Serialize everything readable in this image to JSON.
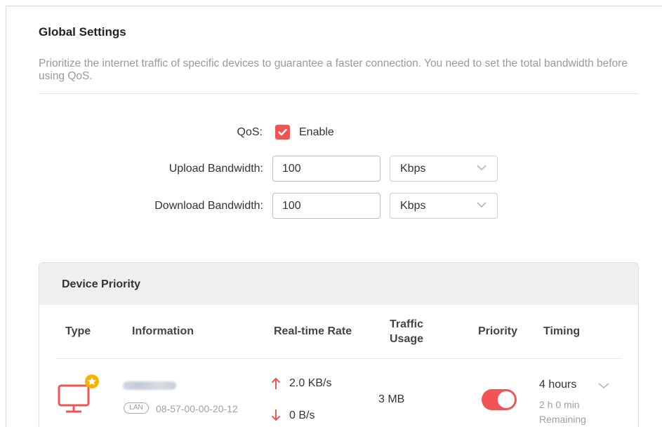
{
  "global": {
    "title": "Global Settings",
    "description": "Prioritize the internet traffic of specific devices to guarantee a faster connection. You need to set the total bandwidth before using QoS."
  },
  "qos": {
    "label": "QoS:",
    "enable_label": "Enable",
    "enabled": true
  },
  "upload": {
    "label": "Upload Bandwidth:",
    "value": "100",
    "unit": "Kbps"
  },
  "download": {
    "label": "Download Bandwidth:",
    "value": "100",
    "unit": "Kbps"
  },
  "device_priority": {
    "title": "Device Priority",
    "columns": {
      "type": "Type",
      "information": "Information",
      "rate": "Real-time Rate",
      "traffic_line1": "Traffic",
      "traffic_line2": "Usage",
      "priority": "Priority",
      "timing": "Timing"
    },
    "rows": [
      {
        "icon": "monitor-icon",
        "badge": "star-icon",
        "connection": "LAN",
        "mac": "08-57-00-00-20-12",
        "upload_rate": "2.0 KB/s",
        "download_rate": "0 B/s",
        "traffic": "3 MB",
        "priority_on": true,
        "timing": "4 hours",
        "remaining_time": "2 h 0 min",
        "remaining_label": "Remaining"
      }
    ]
  },
  "colors": {
    "accent": "#f25454",
    "muted_text": "#9a9a9a",
    "header_bg": "#efefef"
  }
}
